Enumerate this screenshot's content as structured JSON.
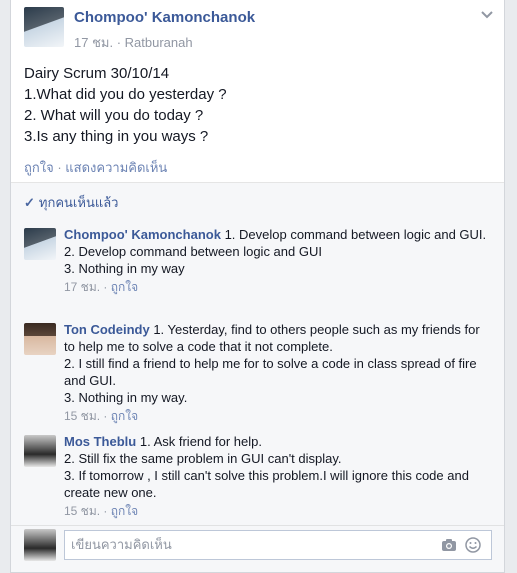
{
  "post": {
    "author": "Chompoo' Kamonchanok",
    "time": "17 ชม.",
    "location": "Ratburanah",
    "lines": [
      "Dairy Scrum 30/10/14",
      "1.What did you do yesterday ?",
      "2. What will you do today ?",
      "3.Is any thing in you ways ?"
    ],
    "like_label": "ถูกใจ",
    "comment_label": "แสดงความคิดเห็น",
    "seen_label": "ทุกคนเห็นแล้ว"
  },
  "comments": [
    {
      "name": "Chompoo' Kamonchanok",
      "lines": [
        "1. Develop command between logic and GUI.",
        "2. Develop command between logic and GUI",
        "3. Nothing in my way"
      ],
      "time": "17 ชม.",
      "like": "ถูกใจ"
    },
    {
      "name": "Ton Codeindy",
      "lines": [
        "1. Yesterday, find to others people such as my friends for to help me to solve a code that it not complete.",
        "2. I still find a friend to help me for to solve a code in class spread of fire and GUI.",
        "3. Nothing in my way."
      ],
      "time": "15 ชม.",
      "like": "ถูกใจ"
    },
    {
      "name": "Mos Theblu",
      "lines": [
        "1. Ask friend for help.",
        "2. Still fix the same problem in GUI can't display.",
        "3. If tomorrow , I still can't solve this problem.I will ignore this code and create new one."
      ],
      "time": "15 ชม.",
      "like": "ถูกใจ"
    }
  ],
  "write_comment": {
    "placeholder": "เขียนความคิดเห็น"
  }
}
